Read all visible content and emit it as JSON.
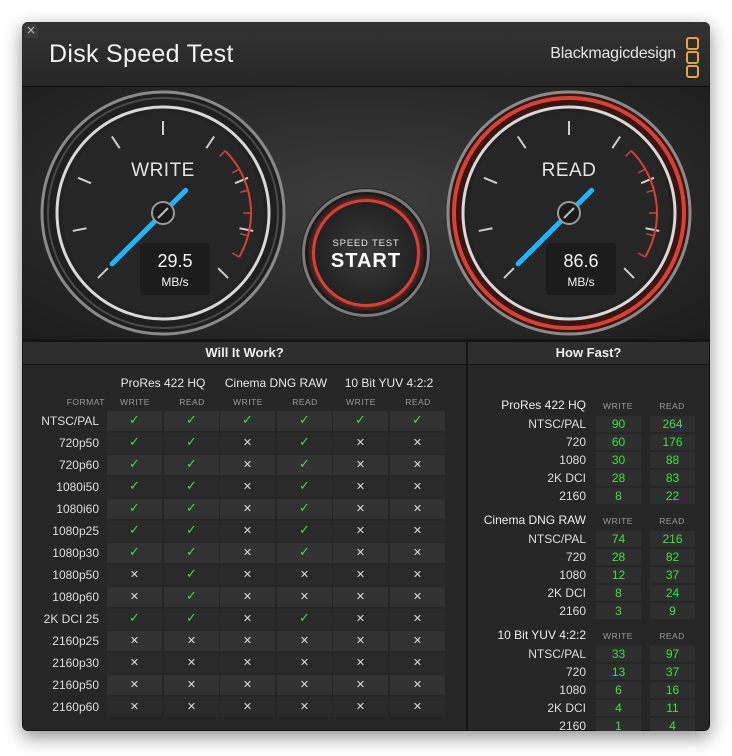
{
  "window": {
    "close_glyph": "×"
  },
  "header": {
    "title": "Disk Speed Test",
    "brand": "Blackmagicdesign"
  },
  "gauges": {
    "write": {
      "label": "WRITE",
      "value": "29.5",
      "unit": "MB/s"
    },
    "read": {
      "label": "READ",
      "value": "86.6",
      "unit": "MB/s"
    }
  },
  "start_button": {
    "small": "SPEED TEST",
    "big": "START"
  },
  "settings": {
    "icon": "gear-icon",
    "glyph": "⚙"
  },
  "colors": {
    "accent_red": "#d64136",
    "needle": "#1fb6ff",
    "ok_green": "#3fe03f"
  },
  "will_it_work": {
    "title": "Will It Work?",
    "format_label": "FORMAT",
    "codecs": [
      "ProRes 422 HQ",
      "Cinema DNG RAW",
      "10 Bit YUV 4:2:2"
    ],
    "sub_labels": [
      "WRITE",
      "READ"
    ],
    "ok_glyph": "✓",
    "no_glyph": "✕",
    "rows": [
      {
        "format": "NTSC/PAL",
        "marks": [
          1,
          1,
          1,
          1,
          1,
          1
        ]
      },
      {
        "format": "720p50",
        "marks": [
          1,
          1,
          0,
          1,
          0,
          0
        ]
      },
      {
        "format": "720p60",
        "marks": [
          1,
          1,
          0,
          1,
          0,
          0
        ]
      },
      {
        "format": "1080i50",
        "marks": [
          1,
          1,
          0,
          1,
          0,
          0
        ]
      },
      {
        "format": "1080i60",
        "marks": [
          1,
          1,
          0,
          1,
          0,
          0
        ]
      },
      {
        "format": "1080p25",
        "marks": [
          1,
          1,
          0,
          1,
          0,
          0
        ]
      },
      {
        "format": "1080p30",
        "marks": [
          1,
          1,
          0,
          1,
          0,
          0
        ]
      },
      {
        "format": "1080p50",
        "marks": [
          0,
          1,
          0,
          0,
          0,
          0
        ]
      },
      {
        "format": "1080p60",
        "marks": [
          0,
          1,
          0,
          0,
          0,
          0
        ]
      },
      {
        "format": "2K DCI 25",
        "marks": [
          1,
          1,
          0,
          1,
          0,
          0
        ]
      },
      {
        "format": "2160p25",
        "marks": [
          0,
          0,
          0,
          0,
          0,
          0
        ]
      },
      {
        "format": "2160p30",
        "marks": [
          0,
          0,
          0,
          0,
          0,
          0
        ]
      },
      {
        "format": "2160p50",
        "marks": [
          0,
          0,
          0,
          0,
          0,
          0
        ]
      },
      {
        "format": "2160p60",
        "marks": [
          0,
          0,
          0,
          0,
          0,
          0
        ]
      }
    ]
  },
  "how_fast": {
    "title": "How Fast?",
    "sub_labels": [
      "WRITE",
      "READ"
    ],
    "groups": [
      {
        "name": "ProRes 422 HQ",
        "rows": [
          {
            "label": "NTSC/PAL",
            "write": "90",
            "read": "264"
          },
          {
            "label": "720",
            "write": "60",
            "read": "176"
          },
          {
            "label": "1080",
            "write": "30",
            "read": "88"
          },
          {
            "label": "2K DCI",
            "write": "28",
            "read": "83"
          },
          {
            "label": "2160",
            "write": "8",
            "read": "22"
          }
        ]
      },
      {
        "name": "Cinema DNG RAW",
        "rows": [
          {
            "label": "NTSC/PAL",
            "write": "74",
            "read": "216"
          },
          {
            "label": "720",
            "write": "28",
            "read": "82"
          },
          {
            "label": "1080",
            "write": "12",
            "read": "37"
          },
          {
            "label": "2K DCI",
            "write": "8",
            "read": "24"
          },
          {
            "label": "2160",
            "write": "3",
            "read": "9"
          }
        ]
      },
      {
        "name": "10 Bit YUV 4:2:2",
        "rows": [
          {
            "label": "NTSC/PAL",
            "write": "33",
            "read": "97"
          },
          {
            "label": "720",
            "write": "13",
            "read": "37"
          },
          {
            "label": "1080",
            "write": "6",
            "read": "16"
          },
          {
            "label": "2K DCI",
            "write": "4",
            "read": "11"
          },
          {
            "label": "2160",
            "write": "1",
            "read": "4"
          }
        ]
      }
    ]
  }
}
